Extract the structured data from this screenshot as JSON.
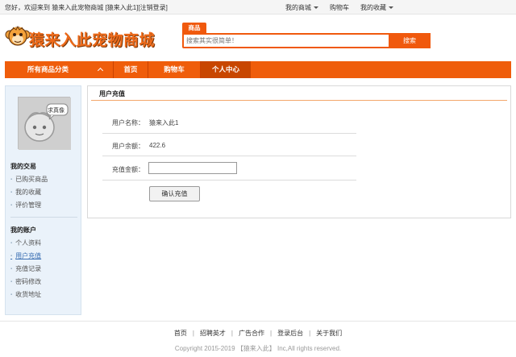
{
  "topbar": {
    "welcome": "您好，欢迎来到",
    "site_name": "猿来入此宠物商城",
    "user": "[猿来入此1][",
    "logout": "注销登录",
    "user_close": "]",
    "my_mall": "我的商城",
    "cart": "购物车",
    "favorites": "我的收藏"
  },
  "header": {
    "logo_text": "猿来入此宠物商城",
    "search_tab": "商品",
    "search_placeholder": "搜索其实很简单！",
    "search_button": "搜索"
  },
  "nav": {
    "categories": "所有商品分类",
    "items": [
      "首页",
      "购物车",
      "个人中心"
    ]
  },
  "sidebar": {
    "avatar_caption": "求真像",
    "section1": "我的交易",
    "trade_items": [
      "已购买商品",
      "我的收藏",
      "评价管理"
    ],
    "section2": "我的账户",
    "account_items": [
      "个人资料",
      "用户充值",
      "充值记录",
      "密码修改",
      "收货地址"
    ]
  },
  "main": {
    "title": "用户充值",
    "username_label": "用户名称：",
    "username": "猿来入此1",
    "balance_label": "用户余额：",
    "balance": "422.6",
    "amount_label": "充值金额：",
    "amount_value": "",
    "confirm_button": "确认充值"
  },
  "footer": {
    "links": [
      "首页",
      "招聘英才",
      "广告合作",
      "登录后台",
      "关于我们"
    ],
    "copyright": "Copyright 2015-2019 【猿来入此】 Inc,All rights reserved."
  },
  "colors": {
    "accent": "#ef5d0b",
    "nav_active": "#c84600",
    "sidebar_bg": "#eaf2fa",
    "link_active": "#3b6fb3"
  }
}
